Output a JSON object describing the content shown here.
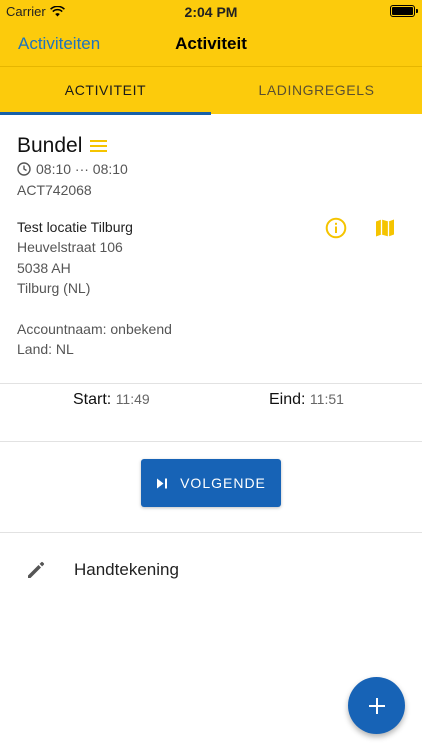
{
  "status_bar": {
    "carrier": "Carrier",
    "time": "2:04 PM"
  },
  "nav": {
    "back_label": "Activiteiten",
    "title": "Activiteit"
  },
  "tabs": [
    {
      "label": "ACTIVITEIT",
      "active": true
    },
    {
      "label": "LADINGREGELS",
      "active": false
    }
  ],
  "activity": {
    "title": "Bundel",
    "time_range": "08:10 ··· 08:10",
    "reference": "ACT742068",
    "location": {
      "name": "Test locatie Tilburg",
      "street": "Heuvelstraat 106",
      "postal": "5038 AH",
      "city": "Tilburg (NL)"
    },
    "account": "Accountnaam: onbekend",
    "country": "Land: NL"
  },
  "times": {
    "start_label": "Start:",
    "start_value": "11:49",
    "end_label": "Eind:",
    "end_value": "11:51"
  },
  "actions": {
    "next_label": "VOLGENDE"
  },
  "signature": {
    "label": "Handtekening"
  },
  "icons": {
    "menu": "hamburger-icon",
    "clock": "clock-icon",
    "info": "info-icon",
    "map": "map-icon",
    "next": "skip-next-icon",
    "pencil": "pencil-icon",
    "add": "plus-icon"
  },
  "colors": {
    "header": "#fccb0c",
    "accent_blue": "#1763b6",
    "link_blue": "#1e73be",
    "icon_yellow": "#f5c400"
  }
}
